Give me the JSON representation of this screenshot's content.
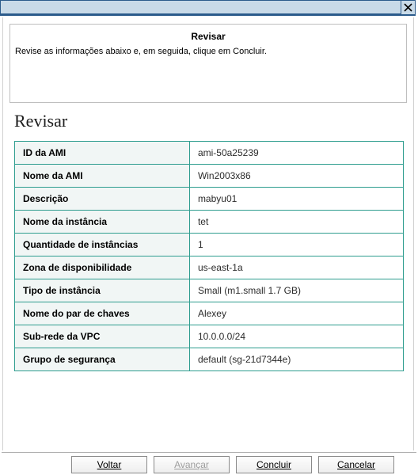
{
  "header": {
    "title": "Revisar",
    "description": "Revise as informações abaixo e, em seguida, clique em Concluir."
  },
  "section": {
    "title": "Revisar"
  },
  "review": [
    {
      "label": "ID da AMI",
      "value": "ami-50a25239"
    },
    {
      "label": "Nome da AMI",
      "value": "Win2003x86"
    },
    {
      "label": "Descrição",
      "value": "mabyu01"
    },
    {
      "label": "Nome da instância",
      "value": "tet"
    },
    {
      "label": "Quantidade de instâncias",
      "value": "1"
    },
    {
      "label": "Zona de disponibilidade",
      "value": "us-east-1a"
    },
    {
      "label": "Tipo de instância",
      "value": "Small (m1.small 1.7 GB)"
    },
    {
      "label": "Nome do par de chaves",
      "value": "Alexey"
    },
    {
      "label": "Sub-rede da VPC",
      "value": "10.0.0.0/24"
    },
    {
      "label": "Grupo de segurança",
      "value": "default (sg-21d7344e)"
    }
  ],
  "buttons": {
    "back": "Voltar",
    "next": "Avançar",
    "finish": "Concluir",
    "cancel": "Cancelar"
  }
}
